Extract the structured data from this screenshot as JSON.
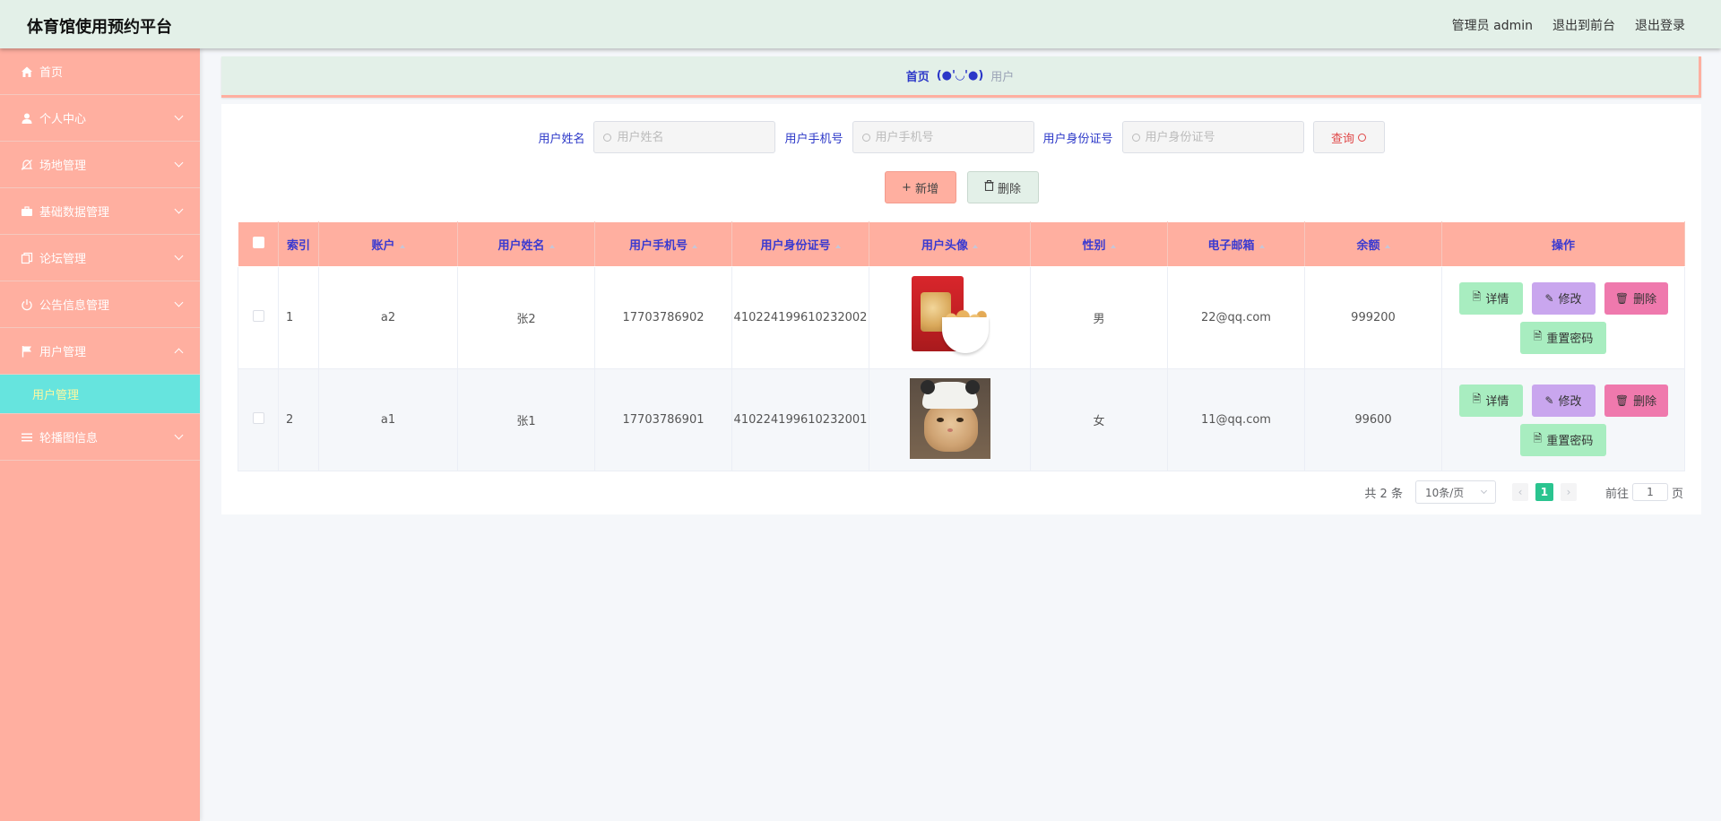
{
  "app": {
    "title": "体育馆使用预约平台",
    "nav": [
      "管理员 admin",
      "退出到前台",
      "退出登录"
    ]
  },
  "sidebar": {
    "items": [
      {
        "label": "首页",
        "icon": "home-icon"
      },
      {
        "label": "个人中心",
        "icon": "user-icon"
      },
      {
        "label": "场地管理",
        "icon": "bell-off-icon"
      },
      {
        "label": "基础数据管理",
        "icon": "briefcase-icon"
      },
      {
        "label": "论坛管理",
        "icon": "copy-icon"
      },
      {
        "label": "公告信息管理",
        "icon": "power-icon"
      },
      {
        "label": "用户管理",
        "icon": "flag-icon"
      },
      {
        "label": "轮播图信息",
        "icon": "list-icon"
      }
    ],
    "active_sub": "用户管理"
  },
  "breadcrumb": {
    "home": "首页",
    "sep": "(●'◡'●)",
    "current": "用户"
  },
  "search": {
    "name_label": "用户姓名",
    "name_placeholder": "用户姓名",
    "phone_label": "用户手机号",
    "phone_placeholder": "用户手机号",
    "idcard_label": "用户身份证号",
    "idcard_placeholder": "用户身份证号",
    "query_label": "查询"
  },
  "actions": {
    "add_label": "新增",
    "delete_label": "删除"
  },
  "table": {
    "headers": [
      "索引",
      "账户",
      "用户姓名",
      "用户手机号",
      "用户身份证号",
      "用户头像",
      "性别",
      "电子邮箱",
      "余额",
      "操作"
    ],
    "rows": [
      {
        "index": "1",
        "account": "a2",
        "name": "张2",
        "phone": "17703786902",
        "idcard": "410224199610232002",
        "avatar": "snack-bag-photo",
        "gender": "男",
        "email": "22@qq.com",
        "balance": "999200"
      },
      {
        "index": "2",
        "account": "a1",
        "name": "张1",
        "phone": "17703786901",
        "idcard": "410224199610232001",
        "avatar": "cat-with-hat-photo",
        "gender": "女",
        "email": "11@qq.com",
        "balance": "99600"
      }
    ],
    "op_labels": {
      "detail": "详情",
      "edit": "修改",
      "delete": "删除",
      "reset": "重置密码"
    }
  },
  "pagination": {
    "total": "共 2 条",
    "page_size": "10条/页",
    "current_page": "1",
    "goto_label": "前往",
    "goto_value": "1",
    "page_suffix": "页"
  },
  "colors": {
    "header_bg": "#e3f0e8",
    "sidebar_bg": "#ffafa0",
    "submenu_active_bg": "#66e4de",
    "submenu_active_text": "#fff8a0",
    "table_header_bg": "#ffafa0",
    "accent_blue": "#2b37c8",
    "pager_active": "#2ac48f"
  }
}
